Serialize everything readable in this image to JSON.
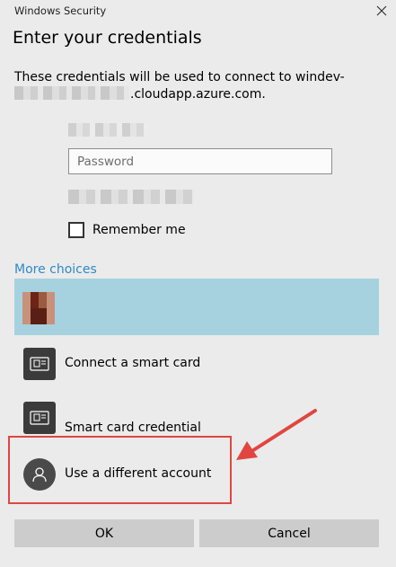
{
  "window": {
    "title": "Windows Security",
    "close_icon": "close-icon"
  },
  "dialog": {
    "heading": "Enter your credentials",
    "description_line1": "These credentials will be used to connect to windev-",
    "description_domain_suffix": ".cloudapp.azure.com."
  },
  "form": {
    "password_placeholder": "Password",
    "password_value": "",
    "remember_label": "Remember me",
    "remember_checked": false
  },
  "more_choices": {
    "label": "More choices",
    "options": [
      {
        "label": "Connect a smart card",
        "icon": "smart-card-icon"
      },
      {
        "label": "Smart card credential",
        "icon": "smart-card-icon"
      },
      {
        "label": "Use a different account",
        "icon": "user-icon"
      }
    ]
  },
  "buttons": {
    "ok": "OK",
    "cancel": "Cancel"
  },
  "annotation": {
    "color": "#e0463f"
  },
  "colors": {
    "background": "#ebebeb",
    "selected_account": "#a6d2e0",
    "link": "#2e8ac7",
    "button": "#cccccc"
  }
}
